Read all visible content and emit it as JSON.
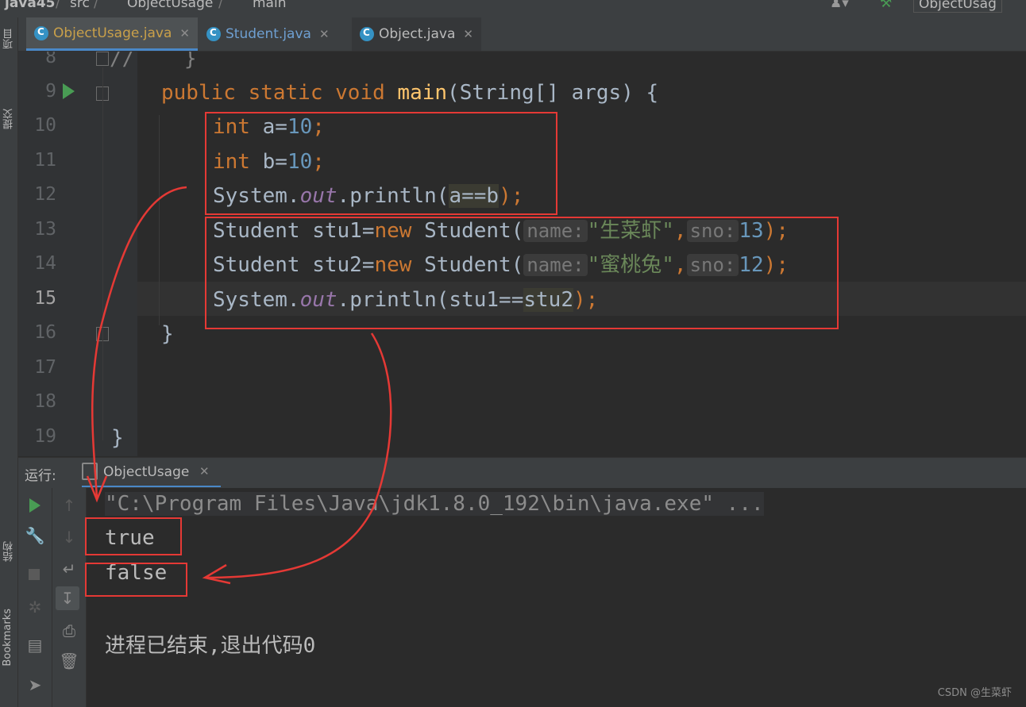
{
  "breadcrumb": {
    "project": "java45",
    "folder": "src",
    "class": "ObjectUsage",
    "method": "main",
    "right_tab": "ObjectUsag"
  },
  "left_strip": {
    "project_label": "项目",
    "commit_label": "提交",
    "structure_label": "结构",
    "bookmarks_label": "Bookmarks"
  },
  "tabs": [
    {
      "label": "ObjectUsage.java",
      "active": true
    },
    {
      "label": "Student.java",
      "active": false
    },
    {
      "label": "Object.java",
      "active": false
    }
  ],
  "editor": {
    "line_numbers": [
      "8",
      "9",
      "10",
      "11",
      "12",
      "13",
      "14",
      "15",
      "16",
      "17",
      "18",
      "19"
    ],
    "line8": "//    }",
    "line9": {
      "kw": "public static void ",
      "fn": "main",
      "rest": "(String[] args) {"
    },
    "line10": {
      "kw": "int",
      "text": " a=",
      "num": "10",
      "end": ";"
    },
    "line11": {
      "kw": "int",
      "text": " b=",
      "num": "10",
      "end": ";"
    },
    "line12": {
      "pre": "System.",
      "field": "out",
      "mid": ".println(",
      "hl": "a==b",
      "end": ");"
    },
    "line13": {
      "pre": "Student stu1=",
      "kw": "new",
      "mid": " Student(",
      "hint1": "name:",
      "str": "\"生菜虾\"",
      "comma": ",",
      "hint2": "sno:",
      "num": "13",
      "end": ");"
    },
    "line14": {
      "pre": "Student stu2=",
      "kw": "new",
      "mid": " Student(",
      "hint1": "name:",
      "str": "\"蜜桃兔\"",
      "comma": ",",
      "hint2": "sno:",
      "num": "12",
      "end": ");"
    },
    "line15": {
      "pre": "System.",
      "field": "out",
      "mid": ".println(stu1==",
      "hl": "stu2",
      "end": ");"
    },
    "line16": "}",
    "line19": "}"
  },
  "run_panel": {
    "label": "运行:",
    "config_tab": "ObjectUsage",
    "output": [
      "\"C:\\Program Files\\Java\\jdk1.8.0_192\\bin\\java.exe\" ...",
      "true",
      "false",
      "",
      "进程已结束,退出代码0"
    ]
  },
  "watermark": "CSDN @生菜虾",
  "colors": {
    "background": "#2b2b2b",
    "keyword": "#cc7832",
    "number": "#6897bb",
    "string": "#6a8759",
    "method": "#ffc66d",
    "static_field": "#9876aa",
    "annotation_red": "#e53935",
    "run_green": "#499c54"
  }
}
